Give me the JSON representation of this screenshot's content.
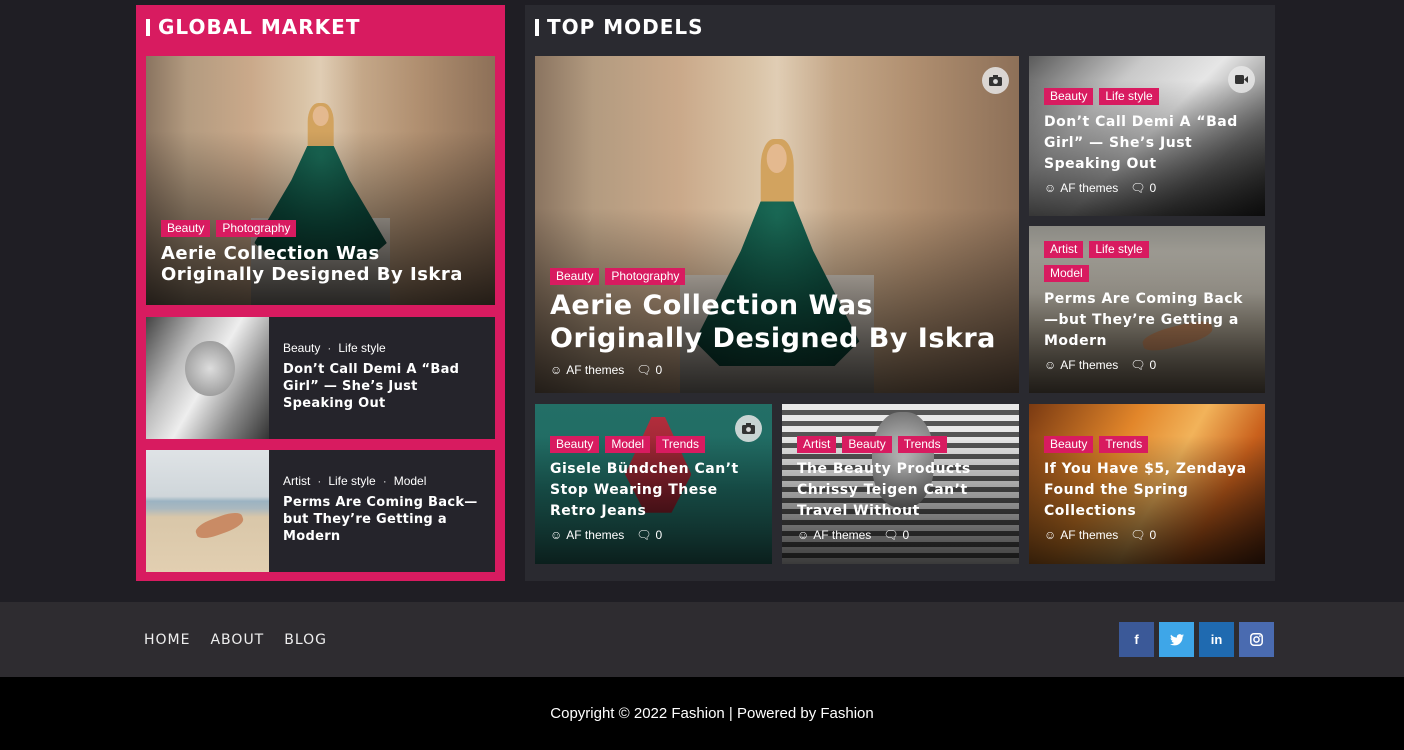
{
  "global_market": {
    "title": "GLOBAL MARKET",
    "featured": {
      "tags": [
        "Beauty",
        "Photography"
      ],
      "title": "Aerie Collection Was Originally Designed By Iskra"
    },
    "list": [
      {
        "cats": [
          "Beauty",
          "Life style"
        ],
        "title": "Don’t Call Demi A “Bad Girl” — She’s Just Speaking Out"
      },
      {
        "cats": [
          "Artist",
          "Life style",
          "Model"
        ],
        "title": "Perms Are Coming Back—but They’re Getting a Modern"
      }
    ]
  },
  "top_models": {
    "title": "TOP MODELS",
    "cards": [
      {
        "tags": [
          "Beauty",
          "Photography"
        ],
        "title": "Aerie Collection Was Originally Designed By Iskra",
        "author": "AF themes",
        "comments": "0",
        "badge": "camera-icon"
      },
      {
        "tags": [
          "Beauty",
          "Life style"
        ],
        "title": "Don’t Call Demi A “Bad Girl” — She’s Just Speaking Out",
        "author": "AF themes",
        "comments": "0",
        "badge": "video-icon"
      },
      {
        "tags": [
          "Artist",
          "Life style",
          "Model"
        ],
        "title": "Perms Are Coming Back—but They’re Getting a Modern",
        "author": "AF themes",
        "comments": "0"
      },
      {
        "tags": [
          "Beauty",
          "Model",
          "Trends"
        ],
        "title": "Gisele Bündchen Can’t Stop Wearing These Retro Jeans",
        "author": "AF themes",
        "comments": "0",
        "badge": "camera-icon"
      },
      {
        "tags": [
          "Artist",
          "Beauty",
          "Trends"
        ],
        "title": "The Beauty Products Chrissy Teigen Can’t Travel Without",
        "author": "AF themes",
        "comments": "0"
      },
      {
        "tags": [
          "Beauty",
          "Trends"
        ],
        "title": "If You Have $5, Zendaya Found the Spring Collections",
        "author": "AF themes",
        "comments": "0"
      }
    ]
  },
  "footer": {
    "nav": [
      "HOME",
      "ABOUT",
      "BLOG"
    ],
    "social": [
      "f",
      "t",
      "in",
      "ig"
    ],
    "copyright": "Copyright © 2022 Fashion | Powered by Fashion"
  },
  "colors": {
    "accent": "#d81b60",
    "background": "#1f1e24"
  }
}
